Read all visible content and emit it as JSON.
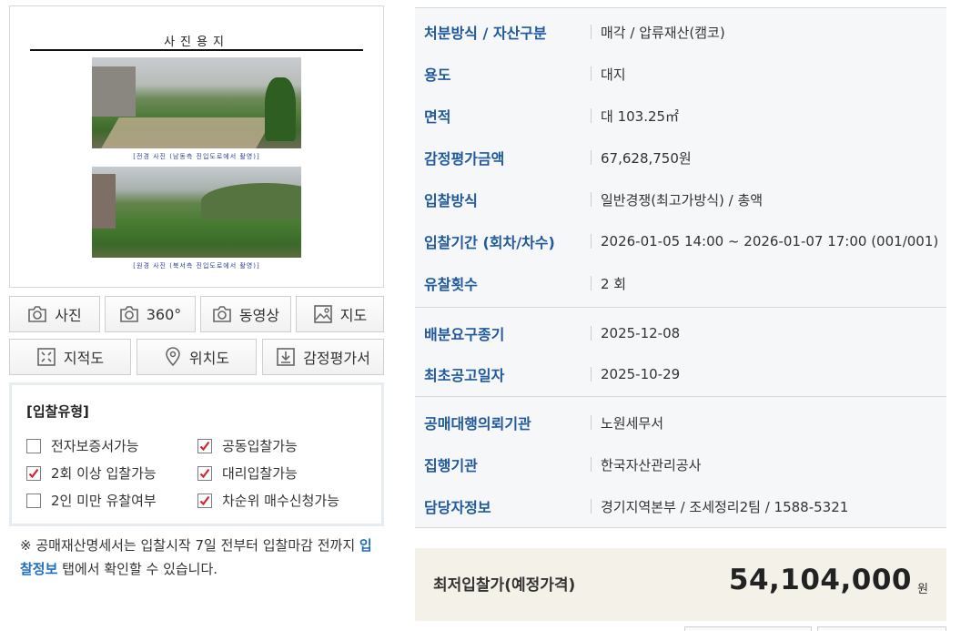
{
  "photo": {
    "doc_title": "사진용지",
    "caption_1": "[전경 사진 (남동측 진입도로에서 촬영)]",
    "caption_2": "[원경 사진 (북서측 진입도로에서 촬영)]"
  },
  "media_buttons": [
    {
      "label": "사진",
      "icon": "camera-icon"
    },
    {
      "label": "360°",
      "icon": "camera-icon"
    },
    {
      "label": "동영상",
      "icon": "camera-icon"
    },
    {
      "label": "지도",
      "icon": "image-icon"
    }
  ],
  "doc_buttons": [
    {
      "label": "지적도",
      "icon": "cadastral-map-icon"
    },
    {
      "label": "위치도",
      "icon": "location-pin-icon"
    },
    {
      "label": "감정평가서",
      "icon": "download-icon"
    }
  ],
  "bid_types": {
    "title": "[입찰유형]",
    "options": [
      {
        "label": "전자보증서가능",
        "checked": false
      },
      {
        "label": "공동입찰가능",
        "checked": true
      },
      {
        "label": "2회 이상 입찰가능",
        "checked": true
      },
      {
        "label": "대리입찰가능",
        "checked": true
      },
      {
        "label": "2인 미만 유찰여부",
        "checked": false
      },
      {
        "label": "차순위 매수신청가능",
        "checked": true
      }
    ]
  },
  "notice": {
    "prefix": "※ 공매재산명세서는 입찰시작 7일 전부터 입찰마감 전까지 ",
    "link": "입찰정보",
    "suffix": " 탭에서 확인할 수 있습니다."
  },
  "info_rows": [
    {
      "label": "처분방식 / 자산구분",
      "value": "매각 / 압류재산(캠코)"
    },
    {
      "label": "용도",
      "value": "대지"
    },
    {
      "label": "면적",
      "value": "대 103.25㎡"
    },
    {
      "label": "감정평가금액",
      "value": "67,628,750원"
    },
    {
      "label": "입찰방식",
      "value": "일반경쟁(최고가방식) / 총액"
    },
    {
      "label": "입찰기간 (회차/차수)",
      "value": "2026-01-05 14:00 ~ 2026-01-07 17:00 (001/001)"
    },
    {
      "label": "유찰횟수",
      "value": "2 회"
    },
    {
      "label": "배분요구종기",
      "value": "2025-12-08"
    },
    {
      "label": "최초공고일자",
      "value": "2025-10-29"
    },
    {
      "label": "공매대행의뢰기관",
      "value": "노원세무서"
    },
    {
      "label": "집행기관",
      "value": "한국자산관리공사"
    },
    {
      "label": "담당자정보",
      "value": "경기지역본부 / 조세정리2팀 / 1588-5321"
    }
  ],
  "price": {
    "label": "최저입찰가(예정가격)",
    "value": "54,104,000",
    "unit": "원"
  },
  "colors": {
    "label_blue": "#21599d",
    "link_blue": "#1f6fbf",
    "check_red": "#d0272e",
    "panel_bg": "#f6f7f9",
    "price_bg": "#f3f1e8"
  }
}
